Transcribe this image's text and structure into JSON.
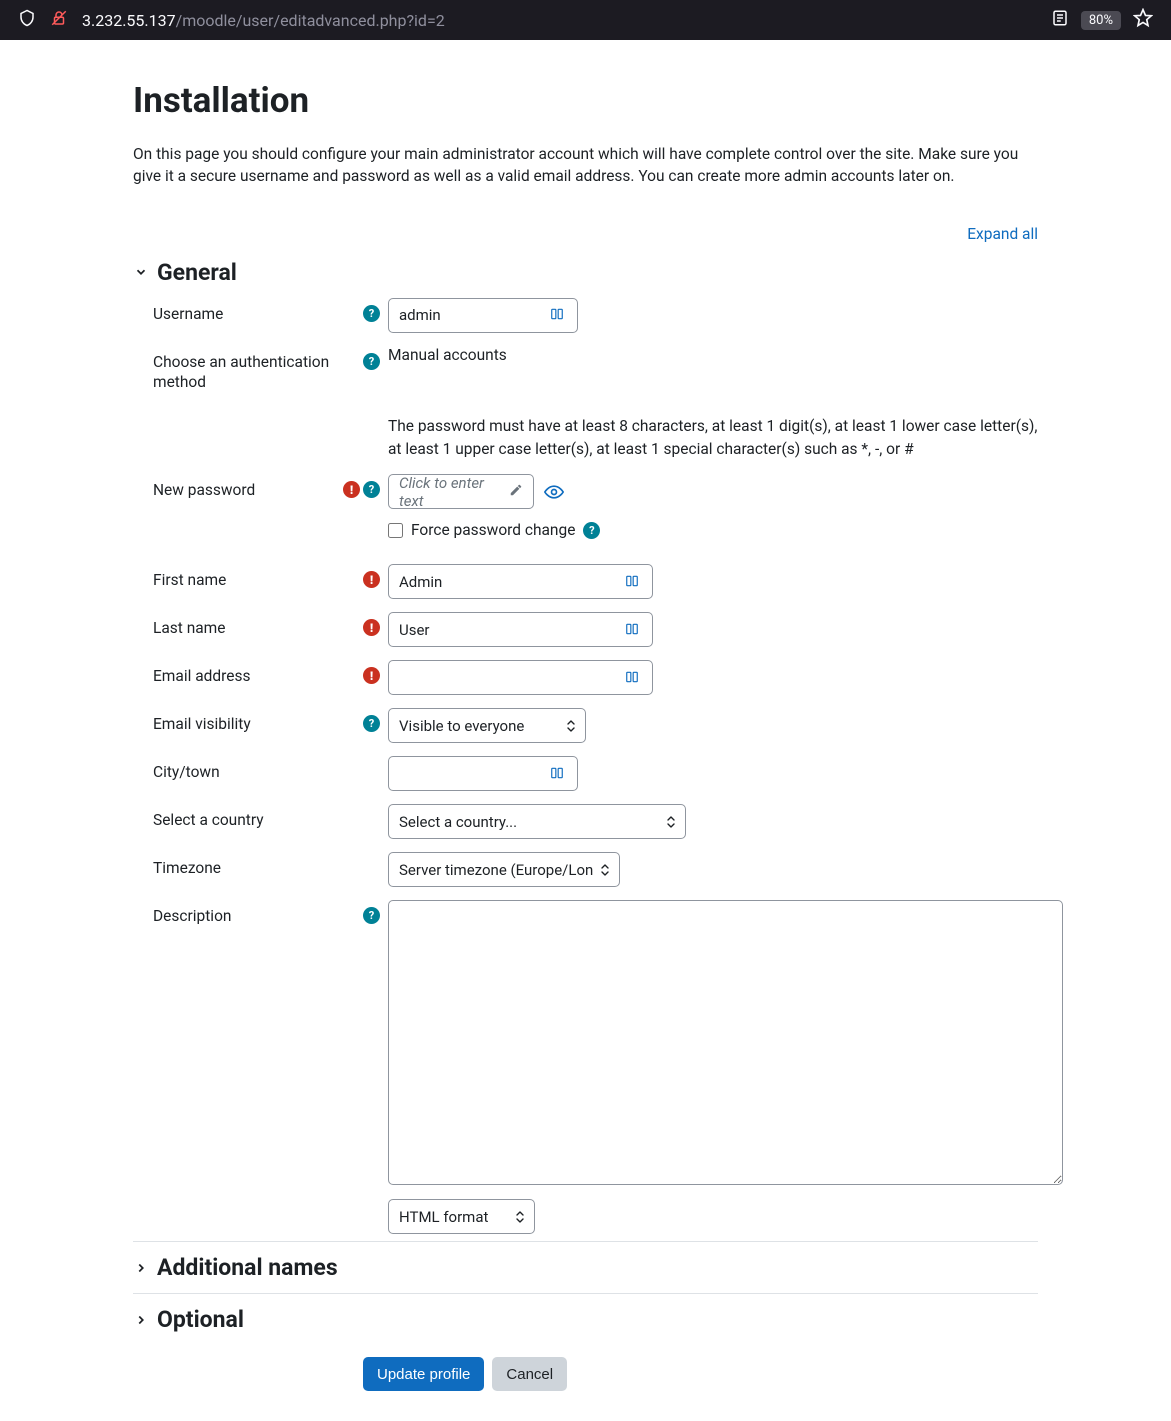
{
  "browser": {
    "url_host": "3.232.55.137",
    "url_path": "/moodle/user/editadvanced.php?id=2",
    "zoom": "80%"
  },
  "page": {
    "title": "Installation",
    "intro": "On this page you should configure your main administrator account which will have complete control over the site. Make sure you give it a secure username and password as well as a valid email address. You can create more admin accounts later on.",
    "expand_all": "Expand all"
  },
  "sections": {
    "general": "General",
    "additional_names": "Additional names",
    "optional": "Optional"
  },
  "labels": {
    "username": "Username",
    "auth_method": "Choose an authentication method",
    "new_password": "New password",
    "force_pw": "Force password change",
    "first_name": "First name",
    "last_name": "Last name",
    "email": "Email address",
    "email_vis": "Email visibility",
    "city": "City/town",
    "country": "Select a country",
    "timezone": "Timezone",
    "description": "Description"
  },
  "values": {
    "username": "admin",
    "auth_method": "Manual accounts",
    "pw_hint": "The password must have at least 8 characters, at least 1 digit(s), at least 1 lower case letter(s), at least 1 upper case letter(s), at least 1 special character(s) such as *, -, or #",
    "pw_placeholder": "Click to enter text",
    "first_name": "Admin",
    "last_name": "User",
    "email": "",
    "email_vis": "Visible to everyone",
    "city": "",
    "country": "Select a country...",
    "timezone": "Server timezone (Europe/London)",
    "desc_format": "HTML format"
  },
  "buttons": {
    "update": "Update profile",
    "cancel": "Cancel"
  }
}
